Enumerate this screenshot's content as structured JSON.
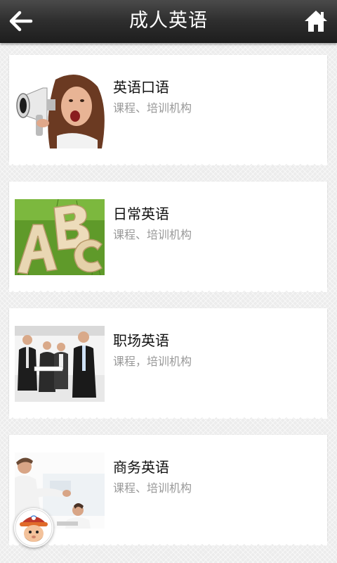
{
  "header": {
    "title": "成人英语",
    "back_icon": "arrow-left-icon",
    "home_icon": "home-icon"
  },
  "courses": [
    {
      "name": "英语口语",
      "desc": "课程、培训机构",
      "thumb": "woman-megaphone-photo"
    },
    {
      "name": "日常英语",
      "desc": "课程、培训机构",
      "thumb": "abc-letters-grass-photo"
    },
    {
      "name": "职场英语",
      "desc": "课程，培训机构",
      "thumb": "business-people-photo"
    },
    {
      "name": "商务英语",
      "desc": "课程、培训机构",
      "thumb": "business-meeting-photo"
    }
  ],
  "floating_button": {
    "icon": "cartoon-chef-avatar-icon"
  },
  "colors": {
    "header_bg": "#2e2e2e",
    "card_bg": "#ffffff",
    "desc_text": "#999999"
  }
}
